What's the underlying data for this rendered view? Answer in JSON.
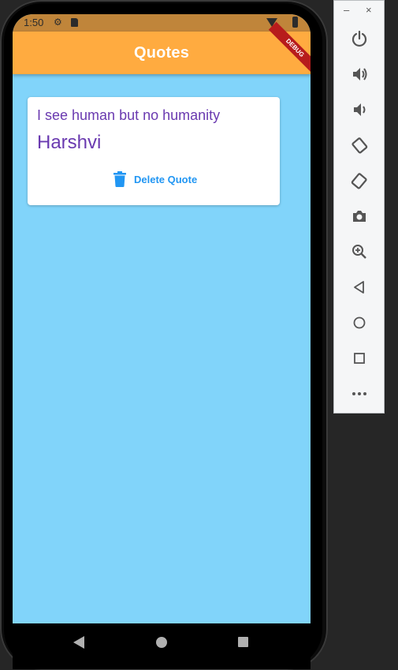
{
  "status_bar": {
    "time": "1:50"
  },
  "app_bar": {
    "title": "Quotes",
    "debug_banner": "DEBUG"
  },
  "quote_card": {
    "text": "I see human but no humanity",
    "author": "Harshvi",
    "delete_label": "Delete Quote"
  },
  "colors": {
    "app_bar": "#ffab40",
    "body_background": "#81d4fa",
    "quote_text": "#6a3ab0",
    "delete_button": "#2196f3",
    "debug_ribbon": "#b71c1c"
  },
  "emulator_panel": {
    "window_controls": [
      "minimize-icon",
      "close-icon"
    ],
    "buttons": [
      "power-icon",
      "volume-up-icon",
      "volume-down-icon",
      "rotate-left-icon",
      "rotate-right-icon",
      "camera-icon",
      "zoom-icon",
      "back-icon",
      "home-icon",
      "overview-icon",
      "more-icon"
    ]
  }
}
